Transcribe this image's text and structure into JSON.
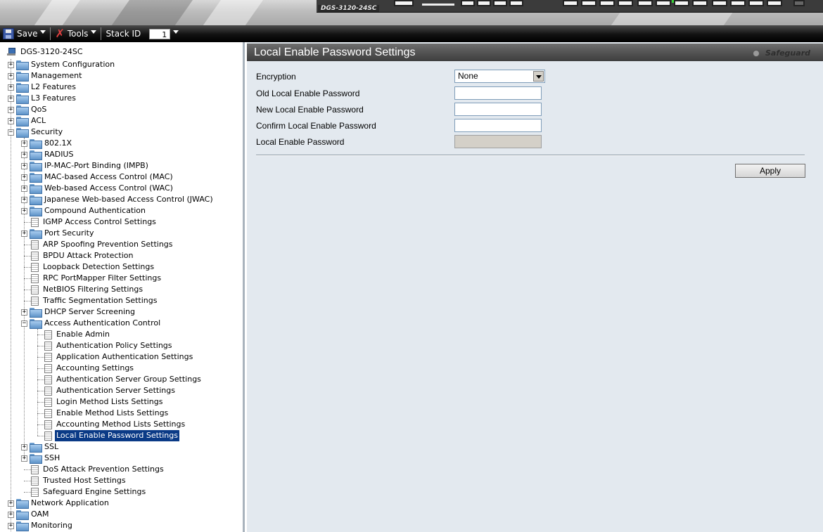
{
  "banner": {
    "device_name": "DGS-3120-24SC"
  },
  "toolbar": {
    "save_label": "Save",
    "tools_label": "Tools",
    "stack_id_label": "Stack ID",
    "stack_id_value": "1"
  },
  "tree": {
    "root": "DGS-3120-24SC",
    "top_items": [
      "System Configuration",
      "Management",
      "L2 Features",
      "L3 Features",
      "QoS",
      "ACL",
      "Security"
    ],
    "security_items": [
      "802.1X",
      "RADIUS",
      "IP-MAC-Port Binding (IMPB)",
      "MAC-based Access Control (MAC)",
      "Web-based Access Control (WAC)",
      "Japanese Web-based Access Control (JWAC)",
      "Compound Authentication",
      "IGMP Access Control Settings",
      "Port Security",
      "ARP Spoofing Prevention Settings",
      "BPDU Attack Protection",
      "Loopback Detection Settings",
      "RPC PortMapper Filter Settings",
      "NetBIOS Filtering Settings",
      "Traffic Segmentation Settings",
      "DHCP Server Screening",
      "Access Authentication Control"
    ],
    "aac_items": [
      "Enable Admin",
      "Authentication Policy Settings",
      "Application Authentication Settings",
      "Accounting Settings",
      "Authentication Server Group Settings",
      "Authentication Server Settings",
      "Login Method Lists Settings",
      "Enable Method Lists Settings",
      "Accounting Method Lists Settings",
      "Local Enable Password Settings"
    ],
    "security_tail": [
      "SSL",
      "SSH",
      "DoS Attack Prevention Settings",
      "Trusted Host Settings",
      "Safeguard Engine Settings"
    ],
    "bottom_items": [
      "Network Application",
      "OAM",
      "Monitoring"
    ]
  },
  "main": {
    "title": "Local Enable Password Settings",
    "safeguard_label": "Safeguard",
    "form": {
      "encryption_label": "Encryption",
      "encryption_value": "None",
      "old_password_label": "Old Local Enable Password",
      "new_password_label": "New Local Enable Password",
      "confirm_password_label": "Confirm Local Enable Password",
      "local_password_label": "Local Enable Password"
    },
    "apply_label": "Apply"
  },
  "colors": {
    "selected_item_bg": "#0a3a86",
    "panel_bg": "#e3e9ef",
    "header_bg": "#4f4f4f"
  }
}
